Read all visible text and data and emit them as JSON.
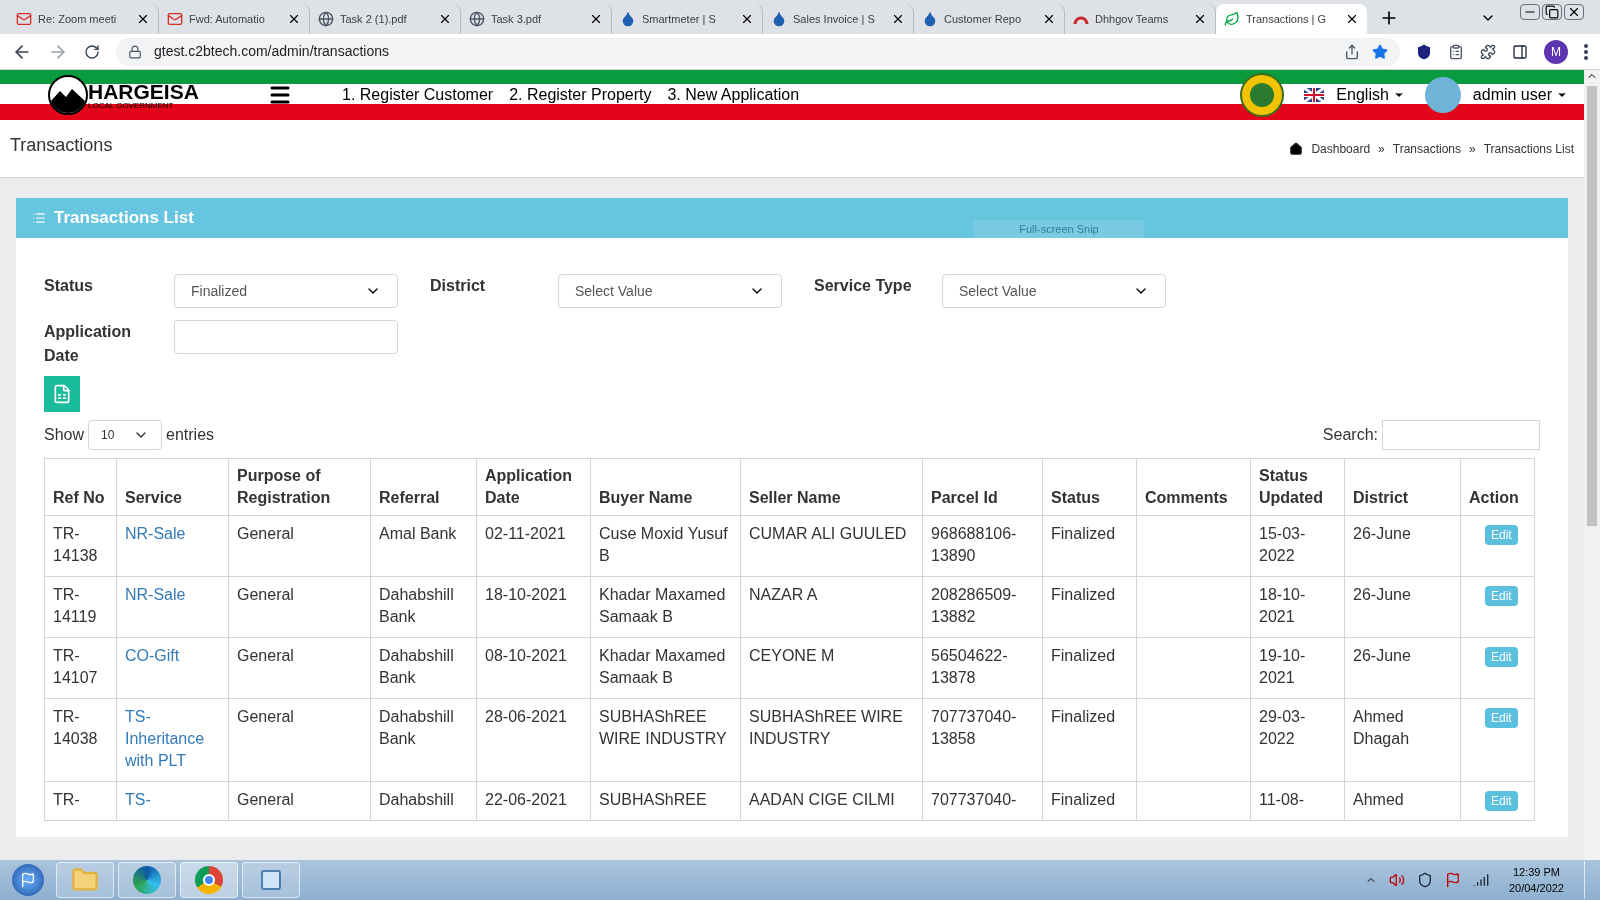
{
  "browser": {
    "tabs": [
      {
        "title": "Re: Zoom meeti",
        "kind": "mail",
        "selected": false
      },
      {
        "title": "Fwd: Automatio",
        "kind": "mail",
        "selected": false
      },
      {
        "title": "Task 2 (1).pdf",
        "kind": "globe",
        "selected": false
      },
      {
        "title": "Task 3.pdf",
        "kind": "globe",
        "selected": false
      },
      {
        "title": "Smartmeter | S",
        "kind": "drop",
        "selected": false
      },
      {
        "title": "Sales Invoice | S",
        "kind": "drop",
        "selected": false
      },
      {
        "title": "Customer Repo",
        "kind": "drop",
        "selected": false
      },
      {
        "title": "Dhhgov Teams",
        "kind": "arc",
        "selected": false
      },
      {
        "title": "Transactions | G",
        "kind": "leaf",
        "selected": true
      }
    ],
    "url": "gtest.c2btech.com/admin/transactions",
    "profile": "M"
  },
  "header": {
    "logo_title": "HARGEISA",
    "logo_subtitle": "LOCAL GOVERNMENT",
    "nav": [
      "1. Register Customer",
      "2. Register Property",
      "3. New Application"
    ],
    "language": "English",
    "user": "admin user"
  },
  "page_title": "Transactions",
  "breadcrumb": [
    "Dashboard",
    "Transactions",
    "Transactions List"
  ],
  "breadcrumb_separator": "»",
  "panel": {
    "title": "Transactions List",
    "snip_hint": "Full-screen Snip"
  },
  "filters": [
    {
      "label": "Status",
      "value": "Finalized",
      "kind": "select"
    },
    {
      "label": "District",
      "value": "Select Value",
      "kind": "select"
    },
    {
      "label": "Service Type",
      "value": "Select Value",
      "kind": "select"
    },
    {
      "label": "Application Date",
      "kind": "input"
    }
  ],
  "show": {
    "before": "Show",
    "value": "10",
    "after": "entries"
  },
  "search_label": "Search:",
  "table": {
    "columns": [
      "Ref No",
      "Service",
      "Purpose of Registration",
      "Referral",
      "Application Date",
      "Buyer Name",
      "Seller Name",
      "Parcel Id",
      "Status",
      "Comments",
      "Status Updated",
      "District",
      "Action"
    ],
    "rows": [
      [
        "TR-14138",
        "NR-Sale",
        "General",
        "Amal Bank",
        "02-11-2021",
        "Cuse Moxid Yusuf B",
        "CUMAR ALI GUULED",
        "968688106-13890",
        "Finalized",
        "",
        "15-03-2022",
        "26-June",
        "Edit"
      ],
      [
        "TR-14119",
        "NR-Sale",
        "General",
        "Dahabshill Bank",
        "18-10-2021",
        "Khadar Maxamed Samaak B",
        "NAZAR A",
        "208286509-13882",
        "Finalized",
        "",
        "18-10-2021",
        "26-June",
        "Edit"
      ],
      [
        "TR-14107",
        "CO-Gift",
        "General",
        "Dahabshill Bank",
        "08-10-2021",
        "Khadar Maxamed Samaak B",
        "CEYONE M",
        "56504622-13878",
        "Finalized",
        "",
        "19-10-2021",
        "26-June",
        "Edit"
      ],
      [
        "TR-14038",
        "TS-Inheritance with PLT",
        "General",
        "Dahabshill Bank",
        "28-06-2021",
        "SUBHAShREE WIRE INDUSTRY",
        "SUBHAShREE WIRE INDUSTRY",
        "707737040-13858",
        "Finalized",
        "",
        "29-03-2022",
        "Ahmed Dhagah",
        "Edit"
      ],
      [
        "TR-",
        "TS-",
        "General",
        "Dahabshill",
        "22-06-2021",
        "SUBHAShREE",
        "AADAN CIGE CILMI",
        "707737040-",
        "Finalized",
        "",
        "11-08-",
        "Ahmed",
        "Edit"
      ]
    ]
  },
  "taskbar": {
    "time": "12:39 PM",
    "date": "20/04/2022"
  }
}
